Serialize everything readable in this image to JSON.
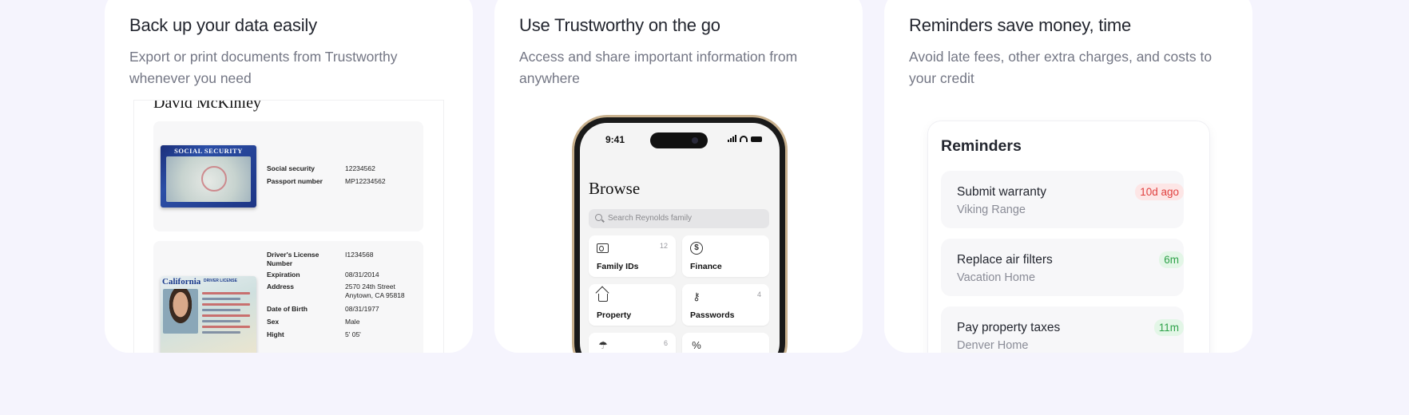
{
  "colors": {
    "page_bg": "#f5f4fd",
    "card_bg": "#ffffff",
    "overdue": "#e0403f",
    "upcoming": "#2fa24a"
  },
  "cards": [
    {
      "title": "Back up your data easily",
      "description": "Export or print documents from Trustworthy whenever you need"
    },
    {
      "title": "Use Trustworthy on the go",
      "description": "Access and share important information from anywhere"
    },
    {
      "title": "Reminders save money, time",
      "description": "Avoid late fees, other extra charges, and costs to your credit"
    }
  ],
  "document": {
    "person_name": "David McKinley",
    "ss_card_text": "SOCIAL SECURITY",
    "ss_fields": [
      {
        "key": "Social security",
        "value": "12234562"
      },
      {
        "key": "Passport number",
        "value": "MP12234562"
      }
    ],
    "dl_state": "California",
    "dl_tag": "DRIVER LICENSE",
    "dl_fields": [
      {
        "key": "Driver's License Number",
        "value": "I1234568"
      },
      {
        "key": "Expiration",
        "value": "08/31/2014"
      },
      {
        "key": "Address",
        "value": "2570 24th Street Anytown, CA 95818"
      },
      {
        "key": "Date of Birth",
        "value": "08/31/1977"
      },
      {
        "key": "Sex",
        "value": "Male"
      },
      {
        "key": "Hight",
        "value": "5' 05'"
      }
    ]
  },
  "phone": {
    "time": "9:41",
    "title": "Browse",
    "search_placeholder": "Search Reynolds family",
    "tiles": [
      {
        "label": "Family IDs",
        "count": "12",
        "icon": "id-card-icon"
      },
      {
        "label": "Finance",
        "count": "",
        "icon": "dollar-coin-icon"
      },
      {
        "label": "Property",
        "count": "",
        "icon": "house-icon"
      },
      {
        "label": "Passwords",
        "count": "4",
        "icon": "key-icon"
      },
      {
        "label": "",
        "count": "6",
        "icon": "umbrella-icon"
      },
      {
        "label": "",
        "count": "",
        "icon": "percent-icon"
      }
    ]
  },
  "reminders": {
    "heading": "Reminders",
    "items": [
      {
        "title": "Submit warranty",
        "subtitle": "Viking Range",
        "badge": "10d ago",
        "status": "overdue"
      },
      {
        "title": "Replace air filters",
        "subtitle": "Vacation Home",
        "badge": "6m",
        "status": "upcoming"
      },
      {
        "title": "Pay property taxes",
        "subtitle": "Denver Home",
        "badge": "11m",
        "status": "upcoming"
      }
    ]
  }
}
